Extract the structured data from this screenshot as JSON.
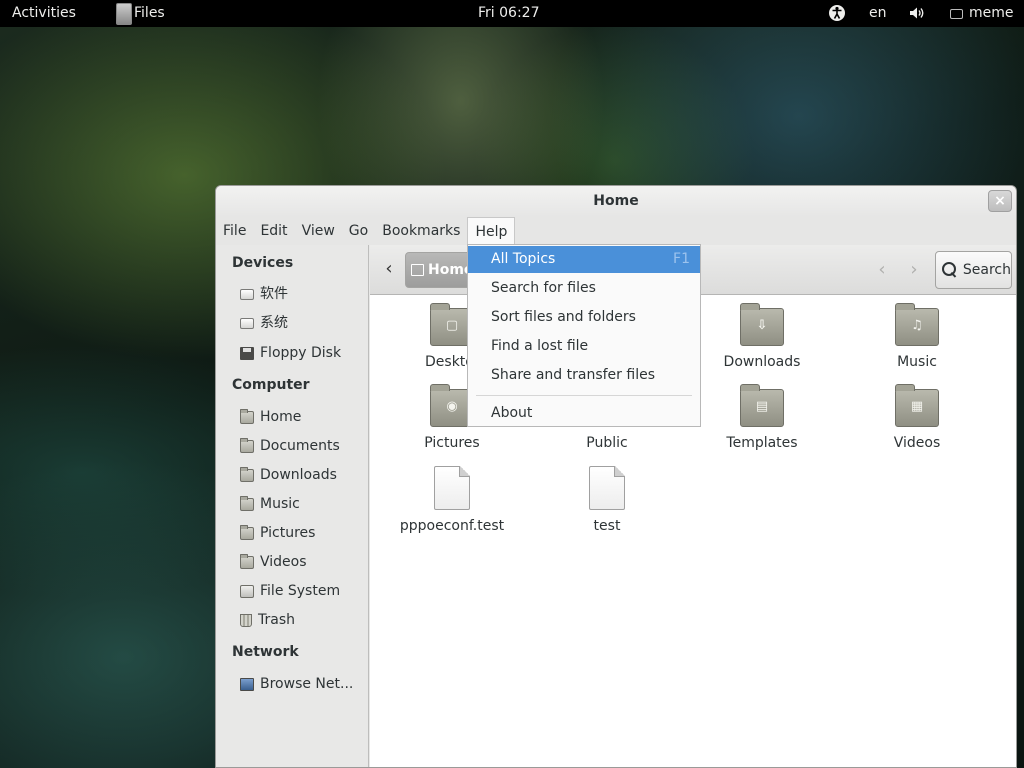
{
  "topbar": {
    "activities": "Activities",
    "app_name": "Files",
    "clock": "Fri 06:27",
    "language": "en",
    "user": "meme"
  },
  "window": {
    "title": "Home",
    "close_glyph": "×"
  },
  "menubar": {
    "items": [
      "File",
      "Edit",
      "View",
      "Go",
      "Bookmarks",
      "Help"
    ],
    "open_menu": "Help"
  },
  "sidebar": {
    "devices_heading": "Devices",
    "devices": [
      {
        "label": "软件",
        "icon": "drive-icon"
      },
      {
        "label": "系统",
        "icon": "drive-icon"
      },
      {
        "label": "Floppy Disk",
        "icon": "floppy-icon"
      }
    ],
    "computer_heading": "Computer",
    "computer": [
      {
        "label": "Home",
        "icon": "home-folder-icon"
      },
      {
        "label": "Documents",
        "icon": "folder-icon"
      },
      {
        "label": "Downloads",
        "icon": "folder-icon"
      },
      {
        "label": "Music",
        "icon": "folder-icon"
      },
      {
        "label": "Pictures",
        "icon": "folder-icon"
      },
      {
        "label": "Videos",
        "icon": "folder-icon"
      },
      {
        "label": "File System",
        "icon": "filesystem-icon"
      },
      {
        "label": "Trash",
        "icon": "trash-icon"
      }
    ],
    "network_heading": "Network",
    "network": [
      {
        "label": "Browse Net...",
        "icon": "network-icon"
      }
    ]
  },
  "toolbar": {
    "path_home": "Home",
    "search_label": "Search"
  },
  "files": [
    {
      "label": "Deskto",
      "type": "folder"
    },
    {
      "label": "Downloads",
      "type": "folder"
    },
    {
      "label": "Music",
      "type": "folder"
    },
    {
      "label": "Pictures",
      "type": "folder"
    },
    {
      "label": "Public",
      "type": "folder"
    },
    {
      "label": "Templates",
      "type": "folder"
    },
    {
      "label": "Videos",
      "type": "folder"
    },
    {
      "label": "pppoeconf.test",
      "type": "file"
    },
    {
      "label": "test",
      "type": "file"
    }
  ],
  "help_menu": {
    "items": [
      {
        "label": "All Topics",
        "accel": "F1",
        "highlighted": true
      },
      {
        "label": "Search for files"
      },
      {
        "label": "Sort files and folders"
      },
      {
        "label": "Find a lost file"
      },
      {
        "label": "Share and transfer files"
      },
      {
        "label": "About"
      }
    ]
  },
  "colors": {
    "selection": "#4a90d9",
    "topbar": "#000000",
    "window_bg": "#e8e8e7"
  }
}
